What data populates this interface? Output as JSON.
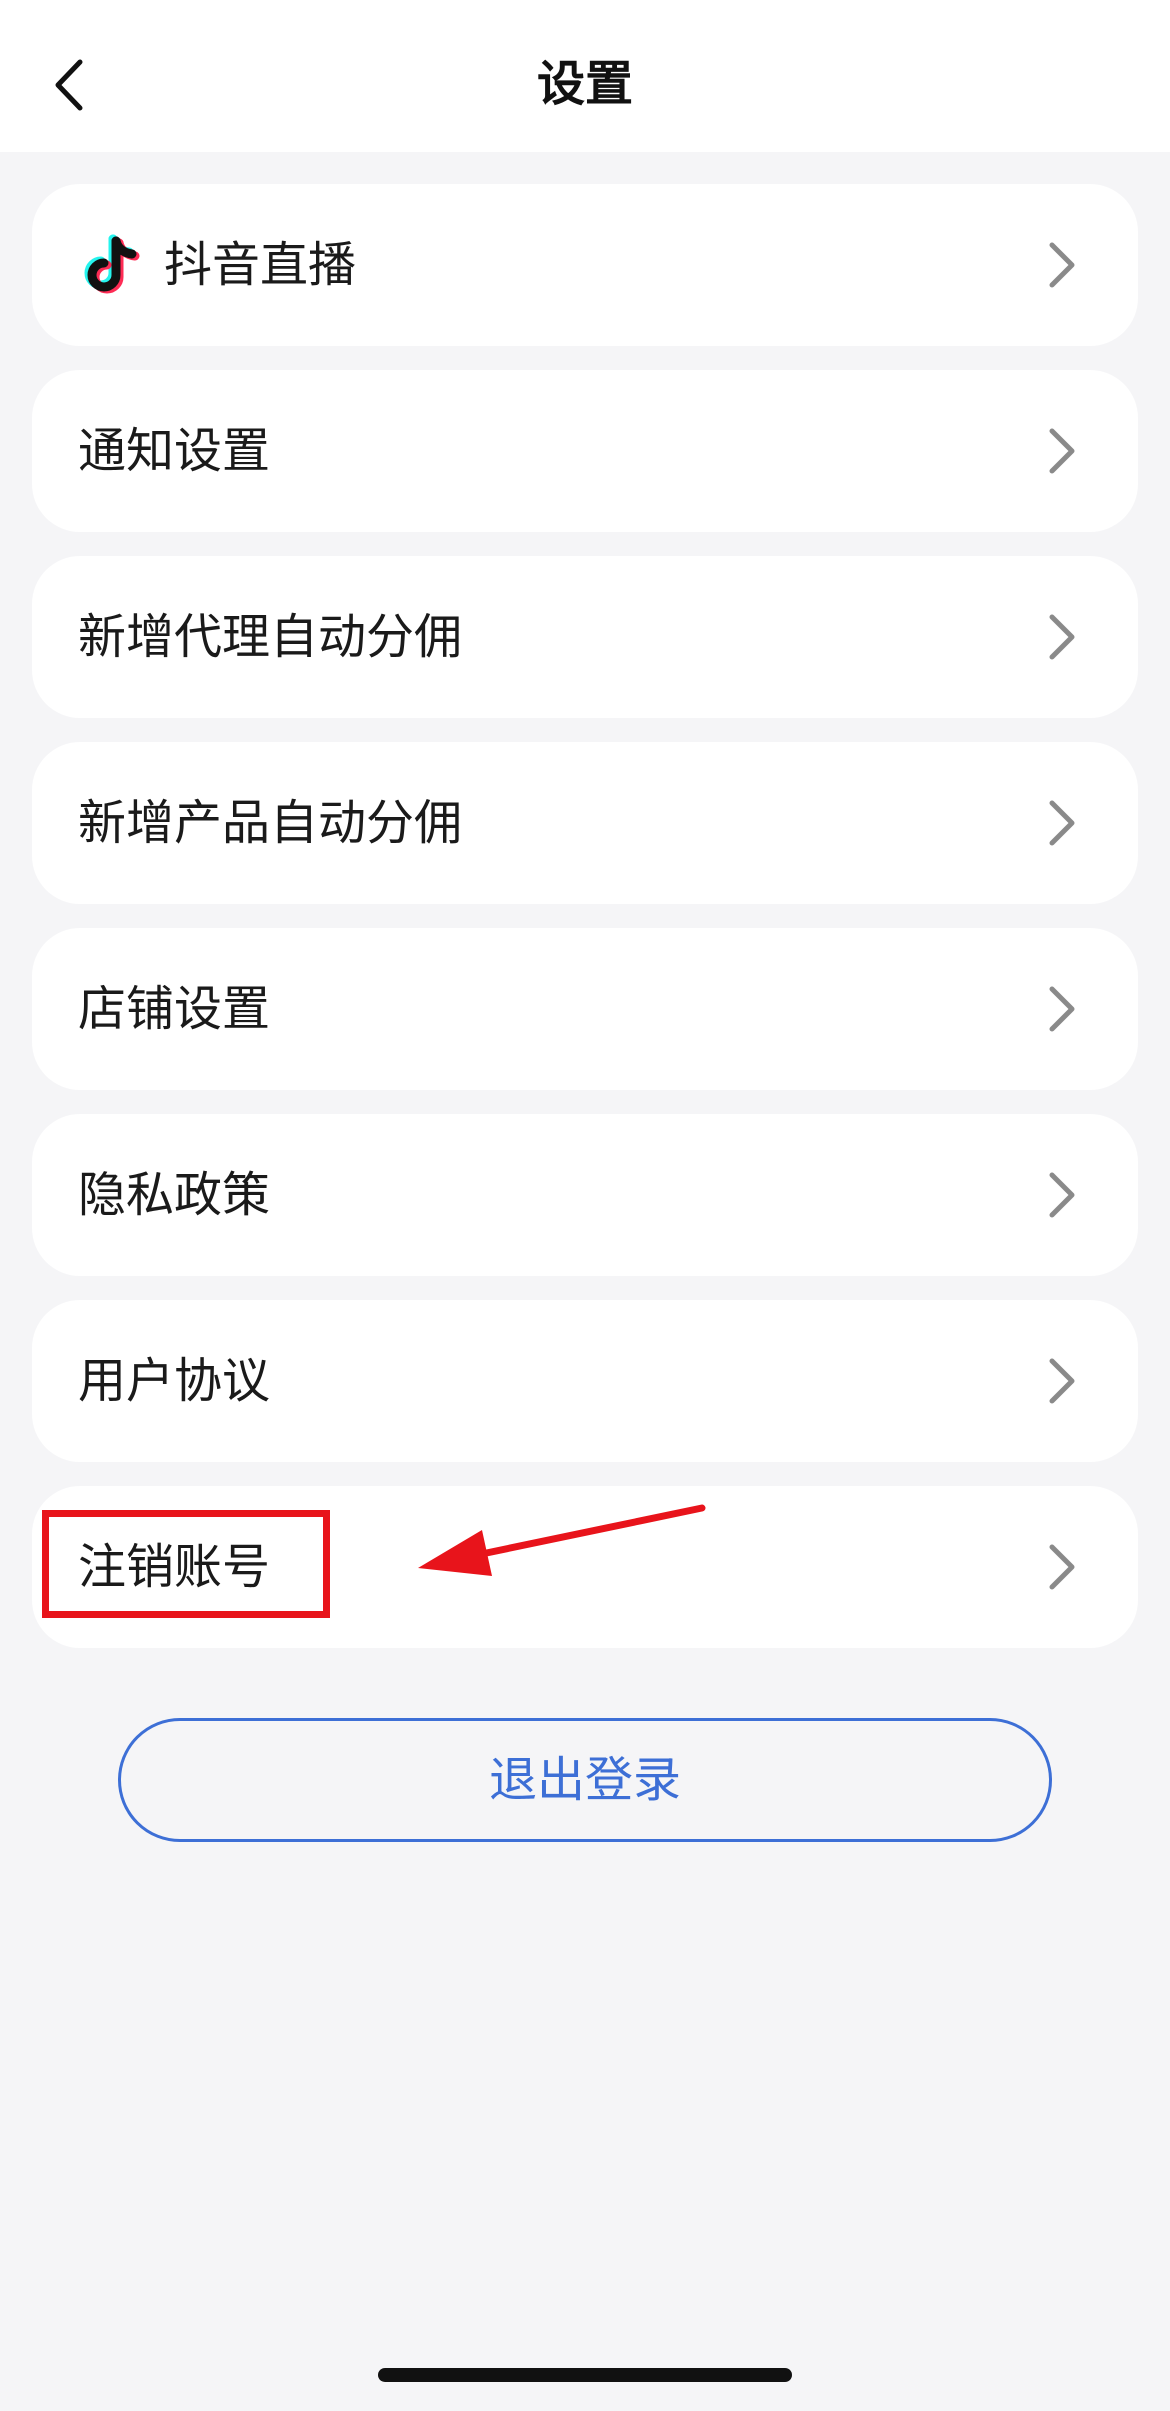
{
  "header": {
    "title": "设置",
    "back_icon": "chevron-left-icon"
  },
  "menu": {
    "items": [
      {
        "label": "抖音直播",
        "icon": "tiktok-logo-icon"
      },
      {
        "label": "通知设置"
      },
      {
        "label": "新增代理自动分佣"
      },
      {
        "label": "新增产品自动分佣"
      },
      {
        "label": "店铺设置"
      },
      {
        "label": "隐私政策"
      },
      {
        "label": "用户协议"
      },
      {
        "label": "注销账号"
      }
    ],
    "chevron_icon": "chevron-right-icon"
  },
  "logout": {
    "label": "退出登录"
  },
  "colors": {
    "background": "#f5f5f7",
    "card": "#ffffff",
    "accent": "#3d6fd6",
    "annotation": "#e8141b",
    "chevron": "#8a8a8a"
  }
}
